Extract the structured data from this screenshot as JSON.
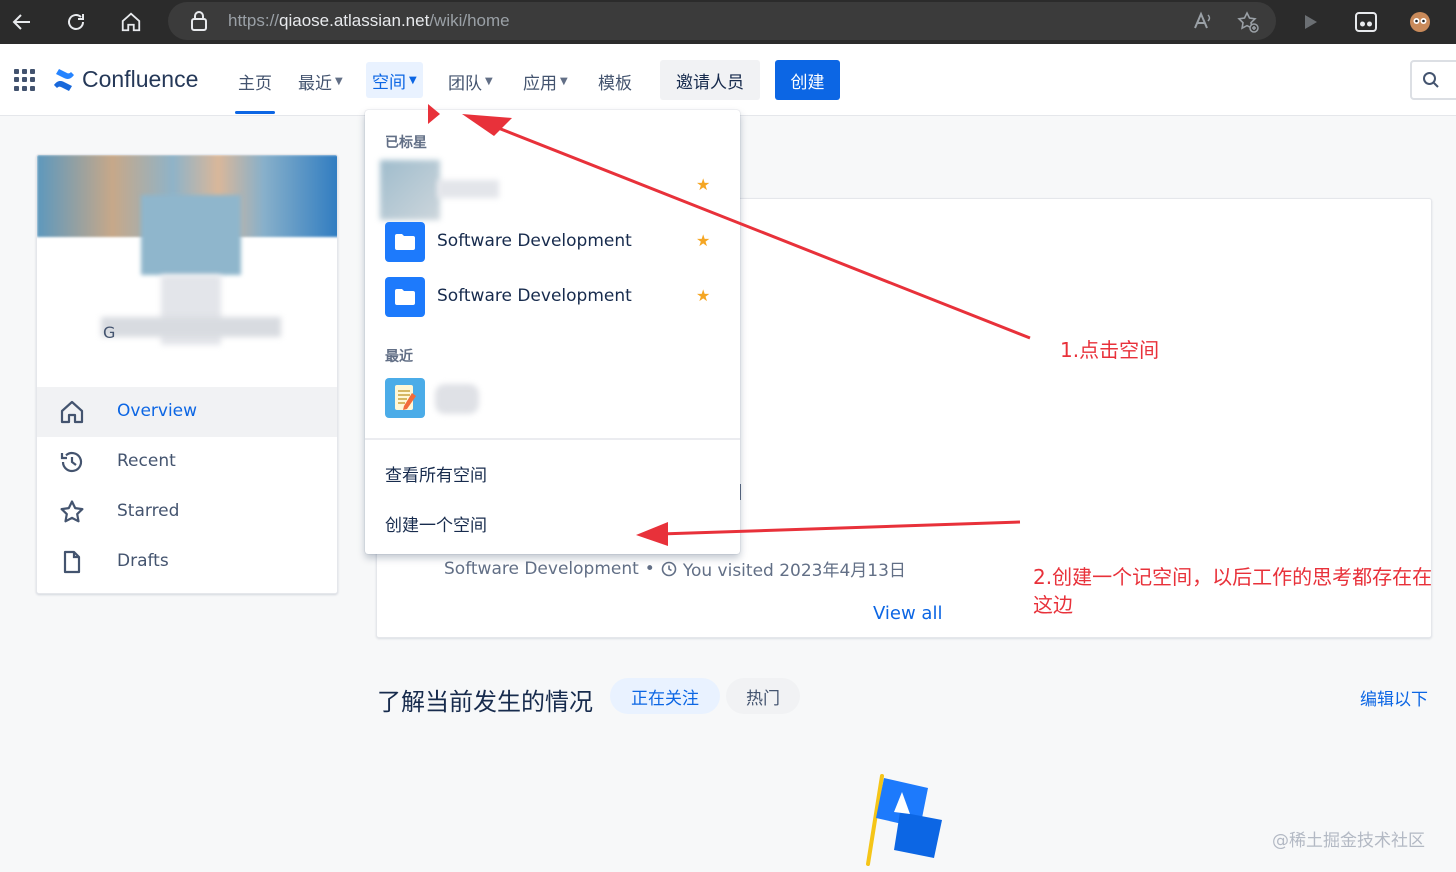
{
  "browser": {
    "url_prefix": "https://",
    "url_host": "qiaose.atlassian.net",
    "url_path": "/wiki/home"
  },
  "header": {
    "logo_text": "Confluence",
    "nav": {
      "home": "主页",
      "recent": "最近",
      "spaces": "空间",
      "teams": "团队",
      "apps": "应用",
      "templates": "模板"
    },
    "invite_label": "邀请人员",
    "create_label": "创建"
  },
  "profile": {
    "initial": "G"
  },
  "sidebar": {
    "items": [
      {
        "label": "Overview",
        "icon": "home-icon",
        "active": true
      },
      {
        "label": "Recent",
        "icon": "history-icon",
        "active": false
      },
      {
        "label": "Starred",
        "icon": "star-icon",
        "active": false
      },
      {
        "label": "Drafts",
        "icon": "document-icon",
        "active": false
      }
    ]
  },
  "dropdown": {
    "starred_heading": "已标星",
    "starred": [
      {
        "name": "Software Development"
      },
      {
        "name": "Software Development"
      }
    ],
    "recent_heading": "最近",
    "view_all_spaces": "查看所有空间",
    "create_space": "创建一个空间"
  },
  "main": {
    "visit_space": "Software Development",
    "visit_sep": "•",
    "visit_text": "You visited 2023年4月13日",
    "view_all": "View all"
  },
  "feed": {
    "title": "了解当前发生的情况",
    "tab_following": "正在关注",
    "tab_popular": "热门",
    "edit_below": "编辑以下"
  },
  "annotations": {
    "step1": "1.点击空间",
    "step2_line1": "2.创建一个记空间，以后工作的思考都存在在",
    "step2_line2": "这边",
    "color": "#e8313a"
  },
  "watermark": "@稀土掘金技术社区",
  "colors": {
    "accent": "#0c66e4",
    "star": "#f5a623",
    "browser_bg": "#2b2b2b"
  }
}
